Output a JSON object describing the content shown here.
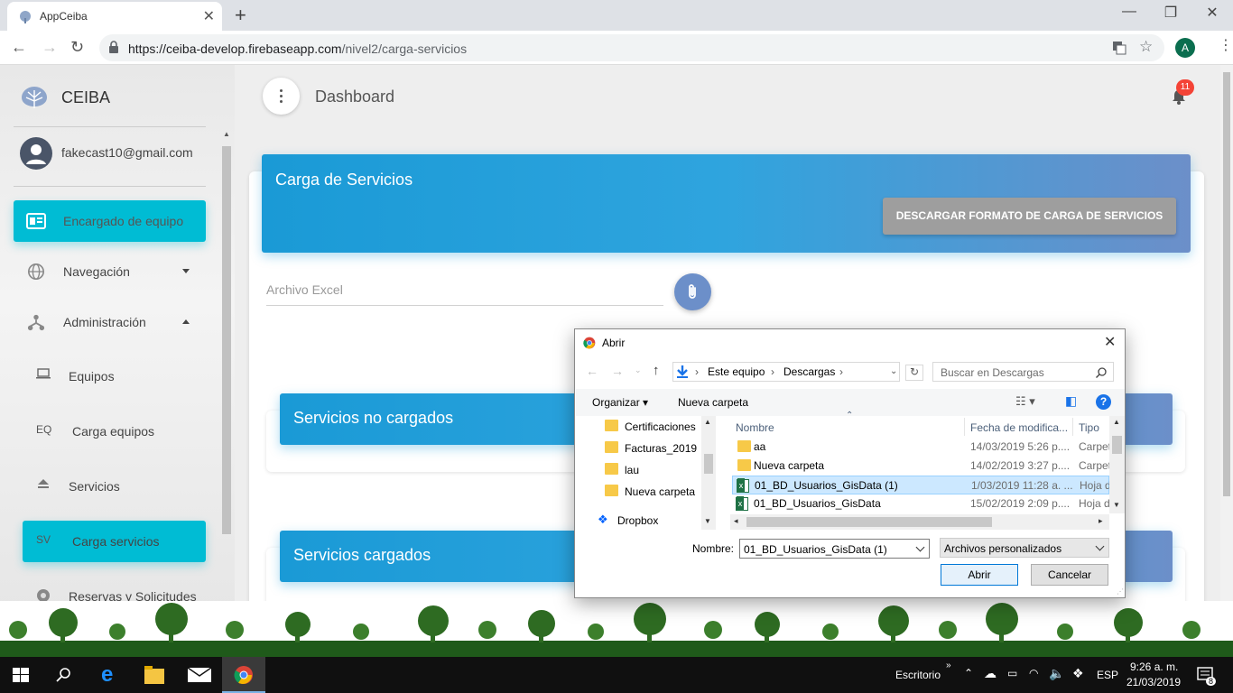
{
  "browser": {
    "tab_title": "AppCeiba",
    "url_host": "https://ceiba-develop.firebaseapp.com",
    "url_path": "/nivel2/carga-servicios",
    "profile_initial": "A"
  },
  "sidebar": {
    "brand": "CEIBA",
    "user_email": "fakecast10@gmail.com",
    "items": [
      {
        "label": "Encargado de equipo",
        "icon": "dashboard-icon",
        "active": true
      },
      {
        "label": "Navegación",
        "icon": "globe-icon"
      },
      {
        "label": "Administración",
        "icon": "hierarchy-icon"
      }
    ],
    "subitems": [
      {
        "abbr": "",
        "label": "Equipos",
        "icon": "laptop-icon"
      },
      {
        "abbr": "EQ",
        "label": "Carga equipos"
      },
      {
        "abbr": "",
        "label": "Servicios",
        "icon": "eject-icon"
      },
      {
        "abbr": "SV",
        "label": "Carga servicios",
        "active": true
      },
      {
        "abbr": "",
        "label": "Reservas y Solicitudes",
        "icon": "settings-icon"
      }
    ]
  },
  "header": {
    "title": "Dashboard",
    "notifications": "11"
  },
  "main": {
    "card_title": "Carga de Servicios",
    "download_button": "DESCARGAR FORMATO DE CARGA DE SERVICIOS",
    "file_label": "Archivo Excel",
    "section_not_loaded": "Servicios no cargados",
    "section_loaded": "Servicios cargados"
  },
  "dialog": {
    "title": "Abrir",
    "breadcrumb": [
      "Este equipo",
      "Descargas"
    ],
    "search_placeholder": "Buscar en Descargas",
    "organize": "Organizar",
    "new_folder": "Nueva carpeta",
    "tree": [
      "Certificaciones",
      "Facturas_2019",
      "lau",
      "Nueva carpeta",
      "Dropbox"
    ],
    "columns": {
      "name": "Nombre",
      "date": "Fecha de modifica...",
      "type": "Tipo"
    },
    "files": [
      {
        "name": "aa",
        "date": "14/03/2019 5:26 p....",
        "type": "Carpeta",
        "kind": "folder"
      },
      {
        "name": "Nueva carpeta",
        "date": "14/02/2019 3:27 p....",
        "type": "Carpeta",
        "kind": "folder"
      },
      {
        "name": "01_BD_Usuarios_GisData (1)",
        "date": "1/03/2019 11:28 a. ...",
        "type": "Hoja de",
        "kind": "excel",
        "selected": true
      },
      {
        "name": "01_BD_Usuarios_GisData",
        "date": "15/02/2019 2:09 p....",
        "type": "Hoja de",
        "kind": "excel"
      }
    ],
    "name_label": "Nombre:",
    "name_value": "01_BD_Usuarios_GisData (1)",
    "file_type": "Archivos personalizados",
    "open_button": "Abrir",
    "cancel_button": "Cancelar"
  },
  "taskbar": {
    "desktop_label": "Escritorio",
    "language": "ESP",
    "time": "9:26 a. m.",
    "date": "21/03/2019",
    "notification_count": "8"
  },
  "colors": {
    "accent_cyan": "#00bcd4",
    "header_blue": "#1a9ad6",
    "badge_red": "#f44336"
  }
}
